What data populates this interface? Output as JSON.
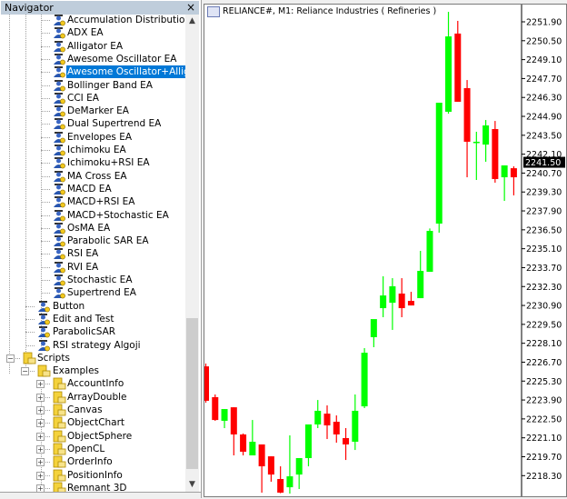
{
  "navigator": {
    "title": "Navigator",
    "close_label": "×",
    "items": [
      {
        "label": "Accumulation Distribution EA",
        "type": "ea",
        "level": 3
      },
      {
        "label": "ADX EA",
        "type": "ea",
        "level": 3
      },
      {
        "label": "Alligator EA",
        "type": "ea",
        "level": 3
      },
      {
        "label": "Awesome Oscillator EA",
        "type": "ea",
        "level": 3
      },
      {
        "label": "Awesome Oscillator+Alligator",
        "type": "ea",
        "level": 3,
        "selected": true
      },
      {
        "label": "Bollinger Band EA",
        "type": "ea",
        "level": 3
      },
      {
        "label": "CCI EA",
        "type": "ea",
        "level": 3
      },
      {
        "label": "DeMarker EA",
        "type": "ea",
        "level": 3
      },
      {
        "label": "Dual Supertrend EA",
        "type": "ea",
        "level": 3
      },
      {
        "label": "Envelopes EA",
        "type": "ea",
        "level": 3
      },
      {
        "label": "Ichimoku EA",
        "type": "ea",
        "level": 3
      },
      {
        "label": "Ichimoku+RSI EA",
        "type": "ea",
        "level": 3
      },
      {
        "label": "MA Cross EA",
        "type": "ea",
        "level": 3
      },
      {
        "label": "MACD EA",
        "type": "ea",
        "level": 3
      },
      {
        "label": "MACD+RSI EA",
        "type": "ea",
        "level": 3
      },
      {
        "label": "MACD+Stochastic EA",
        "type": "ea",
        "level": 3
      },
      {
        "label": "OsMA EA",
        "type": "ea",
        "level": 3
      },
      {
        "label": "Parabolic SAR EA",
        "type": "ea",
        "level": 3
      },
      {
        "label": "RSI EA",
        "type": "ea",
        "level": 3
      },
      {
        "label": "RVI EA",
        "type": "ea",
        "level": 3
      },
      {
        "label": "Stochastic EA",
        "type": "ea",
        "level": 3
      },
      {
        "label": "Supertrend EA",
        "type": "ea",
        "level": 3
      },
      {
        "label": "Button",
        "type": "ea",
        "level": 2
      },
      {
        "label": "Edit and Test",
        "type": "ea",
        "level": 2
      },
      {
        "label": "ParabolicSAR",
        "type": "ea",
        "level": 2
      },
      {
        "label": "RSI strategy Algoji",
        "type": "ea",
        "level": 2
      },
      {
        "label": "Scripts",
        "type": "script-root",
        "level": 1,
        "expander": "-"
      },
      {
        "label": "Examples",
        "type": "folder",
        "level": 2,
        "expander": "-"
      },
      {
        "label": "AccountInfo",
        "type": "folder",
        "level": 3,
        "expander": "+"
      },
      {
        "label": "ArrayDouble",
        "type": "folder",
        "level": 3,
        "expander": "+"
      },
      {
        "label": "Canvas",
        "type": "folder",
        "level": 3,
        "expander": "+"
      },
      {
        "label": "ObjectChart",
        "type": "folder",
        "level": 3,
        "expander": "+"
      },
      {
        "label": "ObjectSphere",
        "type": "folder",
        "level": 3,
        "expander": "+"
      },
      {
        "label": "OpenCL",
        "type": "folder",
        "level": 3,
        "expander": "+"
      },
      {
        "label": "OrderInfo",
        "type": "folder",
        "level": 3,
        "expander": "+"
      },
      {
        "label": "PositionInfo",
        "type": "folder",
        "level": 3,
        "expander": "+"
      },
      {
        "label": "Remnant 3D",
        "type": "folder",
        "level": 3,
        "expander": "+"
      }
    ]
  },
  "chart_window": {
    "title": "RELIANCE#, M1:  Reliance Industries ( Refineries )",
    "bull_color": "#00ff00",
    "bear_color": "#ff0000",
    "current_price": "2241.50"
  },
  "chart_data": {
    "type": "candlestick",
    "symbol": "RELIANCE#",
    "timeframe": "M1",
    "ylim": [
      2216.3,
      2252.1
    ],
    "y_ticks": [
      "2251.90",
      "2250.50",
      "2249.10",
      "2247.70",
      "2246.30",
      "2244.90",
      "2243.50",
      "2242.10",
      "2240.70",
      "2239.30",
      "2237.90",
      "2236.50",
      "2235.10",
      "2233.70",
      "2232.30",
      "2230.90",
      "2229.50",
      "2228.10",
      "2226.70",
      "2225.30",
      "2223.90",
      "2222.50",
      "2221.10",
      "2219.70",
      "2218.30"
    ],
    "candles": [
      [
        2226.39,
        2226.6,
        2223.7,
        2223.84
      ],
      [
        2224.11,
        2224.31,
        2222.36,
        2222.42
      ],
      [
        2222.36,
        2223.23,
        2221.82,
        2223.23
      ],
      [
        2223.36,
        2223.36,
        2219.8,
        2221.35
      ],
      [
        2221.35,
        2221.42,
        2219.8,
        2220.07
      ],
      [
        2219.8,
        2222.42,
        2219.8,
        2220.81
      ],
      [
        2220.61,
        2220.61,
        2217.04,
        2218.99
      ],
      [
        2219.73,
        2219.73,
        2217.85,
        2218.38
      ],
      [
        2218.05,
        2218.99,
        2217.0,
        2217.04
      ],
      [
        2217.44,
        2221.28,
        2216.97,
        2218.25
      ],
      [
        2218.38,
        2219.6,
        2217.31,
        2219.6
      ],
      [
        2219.6,
        2222.09,
        2218.99,
        2222.09
      ],
      [
        2222.09,
        2223.9,
        2221.82,
        2223.1
      ],
      [
        2222.89,
        2223.5,
        2221.01,
        2222.02
      ],
      [
        2222.29,
        2222.76,
        2220.74,
        2221.35
      ],
      [
        2221.08,
        2221.82,
        2219.46,
        2220.61
      ],
      [
        2220.81,
        2224.31,
        2220.2,
        2223.1
      ],
      [
        2223.43,
        2227.74,
        2223.3,
        2227.4
      ],
      [
        2228.55,
        2228.7,
        2227.81,
        2229.89
      ],
      [
        2230.7,
        2233.06,
        2230.03,
        2231.64
      ],
      [
        2231.1,
        2232.92,
        2229.09,
        2232.32
      ],
      [
        2231.78,
        2232.92,
        2230.03,
        2230.7
      ],
      [
        2231.24,
        2231.91,
        2230.9,
        2230.9
      ],
      [
        2231.44,
        2234.94,
        2231.44,
        2233.46
      ],
      [
        2233.39,
        2236.6,
        2233.39,
        2236.42
      ],
      [
        2236.96,
        2245.91,
        2236.29,
        2245.91
      ],
      [
        2245.24,
        2252.64,
        2245.1,
        2250.82
      ],
      [
        2251.03,
        2251.97,
        2245.98,
        2245.98
      ],
      [
        2246.99,
        2247.59,
        2240.39,
        2243.02
      ],
      [
        2243.02,
        2243.76,
        2240.19,
        2243.02
      ],
      [
        2242.81,
        2244.63,
        2241.54,
        2244.23
      ],
      [
        2243.96,
        2244.56,
        2239.99,
        2240.26
      ],
      [
        2240.39,
        2241.27,
        2238.64,
        2241.27
      ],
      [
        2241.06,
        2241.2,
        2239.05,
        2240.39
      ]
    ]
  }
}
